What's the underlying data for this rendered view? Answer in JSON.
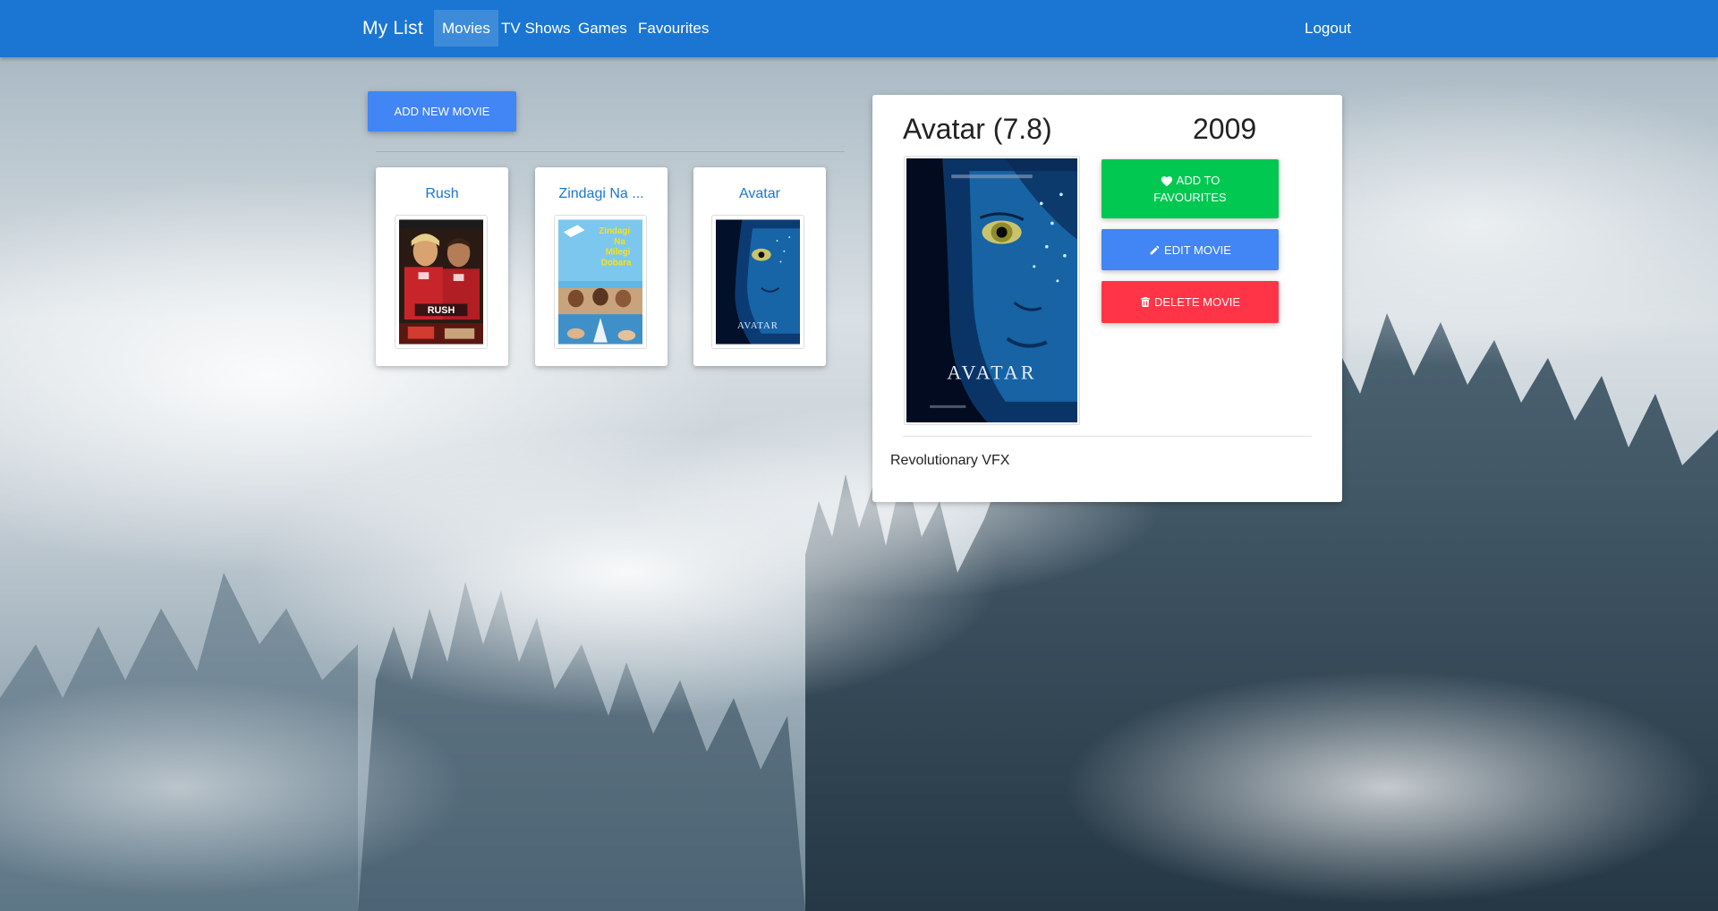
{
  "navbar": {
    "brand": "My List",
    "items": [
      {
        "label": "Movies",
        "active": true
      },
      {
        "label": "TV Shows",
        "active": false
      },
      {
        "label": "Games",
        "active": false
      },
      {
        "label": "Favourites",
        "active": false
      }
    ],
    "logout": "Logout",
    "color": "#1a76d2"
  },
  "toolbar": {
    "add_label": "ADD NEW MOVIE"
  },
  "movies": [
    {
      "title": "Rush",
      "poster_icon": "rush-poster"
    },
    {
      "title": "Zindagi Na ...",
      "poster_icon": "zindagi-poster"
    },
    {
      "title": "Avatar",
      "poster_icon": "avatar-poster"
    }
  ],
  "detail": {
    "title": "Avatar (7.8)",
    "year": "2009",
    "poster_icon": "avatar-poster",
    "buttons": {
      "favourite": "ADD TO FAVOURITES",
      "edit": "EDIT MOVIE",
      "delete": "DELETE MOVIE"
    },
    "description": "Revolutionary VFX"
  },
  "colors": {
    "primary": "#4285f4",
    "success": "#00c851",
    "danger": "#ff3547"
  }
}
